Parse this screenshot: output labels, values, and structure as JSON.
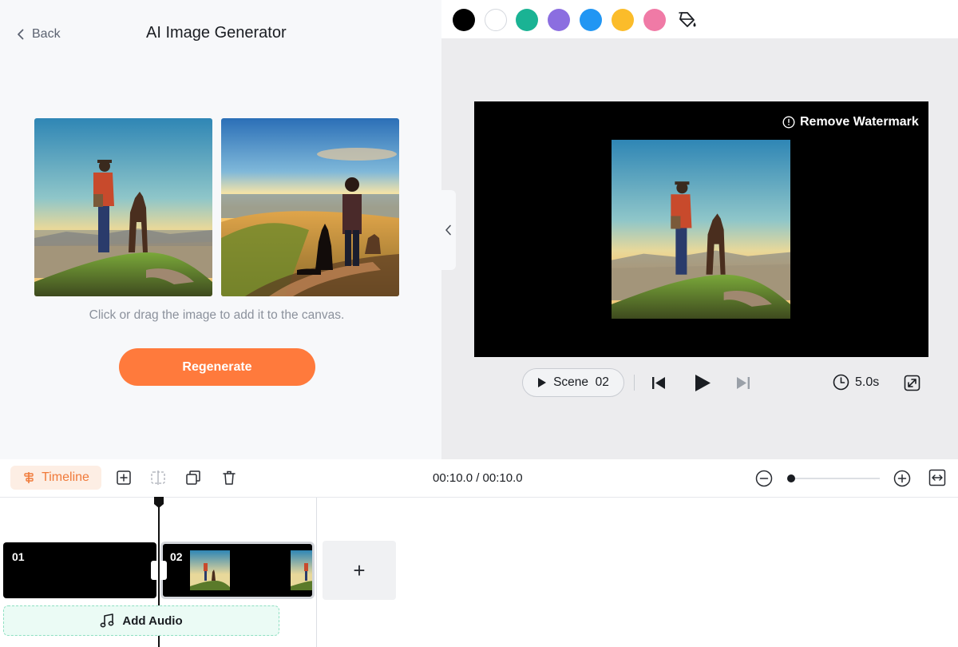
{
  "generator": {
    "back_label": "Back",
    "title": "AI Image Generator",
    "hint": "Click or drag the image to add it to the canvas.",
    "regenerate_label": "Regenerate",
    "results": [
      {
        "name": "generated-image-1"
      },
      {
        "name": "generated-image-2"
      }
    ]
  },
  "palette": {
    "colors": [
      "#000000",
      "#ffffff",
      "#1ab394",
      "#8b6ee0",
      "#2196f3",
      "#fbbc2a",
      "#f07aa6"
    ],
    "fill_icon": "paint-bucket-icon"
  },
  "preview": {
    "watermark_label": "Remove Watermark",
    "scene_label": "Scene  02",
    "duration": "5.0s"
  },
  "timeline": {
    "tab_label": "Timeline",
    "timecode": "00:10.0 / 00:10.0",
    "zoom_level": 0.0,
    "clips": [
      {
        "label": "01"
      },
      {
        "label": "02"
      }
    ],
    "add_scene_label": "+",
    "add_audio_label": "Add Audio"
  }
}
